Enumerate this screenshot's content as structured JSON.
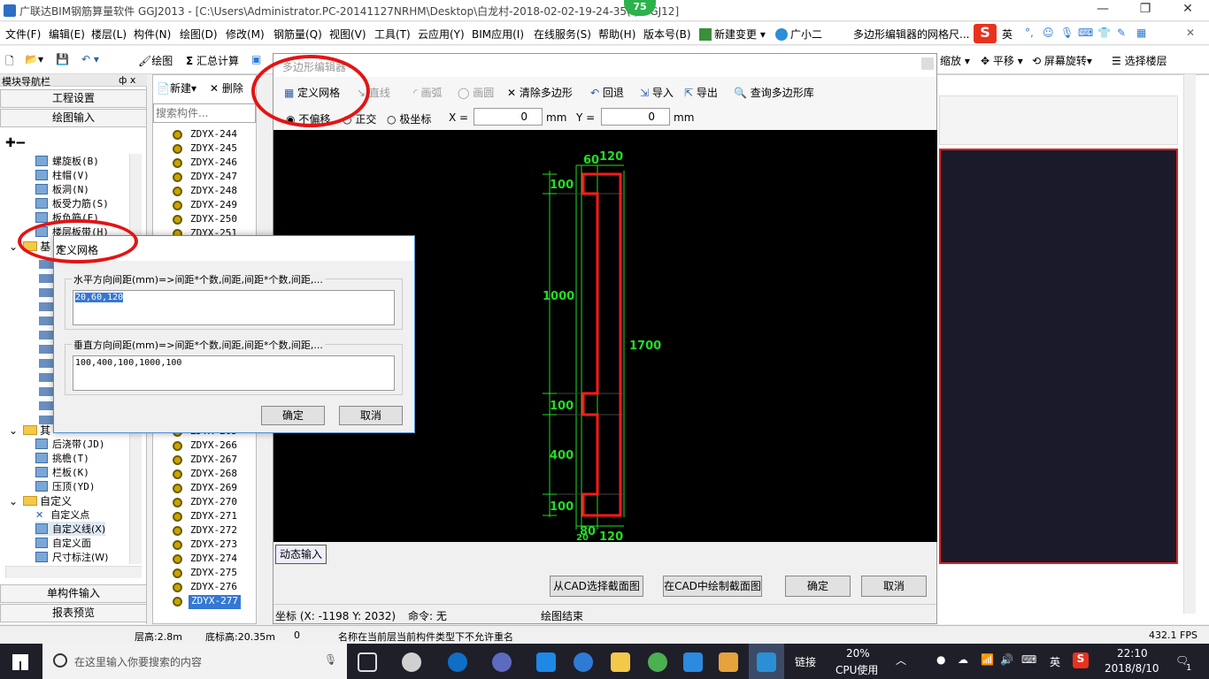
{
  "titlebar": {
    "title": "广联达BIM钢筋算量软件 GGJ2013 - [C:\\Users\\Administrator.PC-20141127NRHM\\Desktop\\白龙村-2018-02-02-19-24-35(    ).GGJ12]",
    "badge": "75"
  },
  "menubar": {
    "items": [
      "文件(F)",
      "编辑(E)",
      "楼层(L)",
      "构件(N)",
      "绘图(D)",
      "修改(M)",
      "钢筋量(Q)",
      "视图(V)",
      "工具(T)",
      "云应用(Y)",
      "BIM应用(I)",
      "在线服务(S)",
      "帮助(H)",
      "版本号(B)",
      "新建变更",
      "广小二"
    ],
    "ticker": "多边形编辑器的网格尺...",
    "ime": "英"
  },
  "toolbar": {
    "draw": "绘图",
    "sum": "汇总计算",
    "zoom": "缩放",
    "pan": "平移",
    "rotate": "屏幕旋转",
    "floor": "选择楼层"
  },
  "nav": {
    "title": "模块导航栏",
    "pin": "ф x",
    "settings": "工程设置",
    "drawinput": "绘图输入",
    "single": "单构件输入",
    "report": "报表预览",
    "items": [
      "螺旋板(B)",
      "柱帽(V)",
      "板洞(N)",
      "板受力筋(S)",
      "板负筋(F)",
      "楼层板带(H)"
    ],
    "folder_base": "基",
    "folder_other": "其",
    "other_items": [
      "后浇带(JD)",
      "挑檐(T)",
      "栏板(K)",
      "压顶(YD)"
    ],
    "folder_custom": "自定义",
    "custom_items": [
      "自定义点",
      "自定义线(X)",
      "自定义面",
      "尺寸标注(W)"
    ]
  },
  "clist": {
    "new": "新建",
    "delete": "删除",
    "search_placeholder": "搜索构件...",
    "top_rows": [
      "ZDYX-244",
      "ZDYX-245",
      "ZDYX-246",
      "ZDYX-247",
      "ZDYX-248",
      "ZDYX-249",
      "ZDYX-250",
      "ZDYX-251"
    ],
    "bottom_rows": [
      "ZDYX-265",
      "ZDYX-266",
      "ZDYX-267",
      "ZDYX-268",
      "ZDYX-269",
      "ZDYX-270",
      "ZDYX-271",
      "ZDYX-272",
      "ZDYX-273",
      "ZDYX-274",
      "ZDYX-275",
      "ZDYX-276",
      "ZDYX-277"
    ]
  },
  "poly": {
    "title": "多边形编辑器",
    "define_grid": "定义网格",
    "line": "直线",
    "arc": "画弧",
    "circle": "画圆",
    "clear": "清除多边形",
    "undo": "回退",
    "import": "导入",
    "export": "导出",
    "query": "查询多边形库",
    "no_offset": "不偏移",
    "ortho": "正交",
    "polar": "极坐标",
    "x_label": "X =",
    "x_value": "0",
    "y_label": "Y =",
    "y_value": "0",
    "unit": "mm",
    "dims": {
      "top_a": "60",
      "top_b": "120",
      "left_1": "100",
      "left_2": "1000",
      "left_3": "100",
      "left_4": "400",
      "left_5": "100",
      "right_total": "1700",
      "bot_a": "20",
      "bot_b": "80",
      "bot_c": "120"
    },
    "dynamic": "动态输入",
    "from_cad": "从CAD选择截面图",
    "in_cad": "在CAD中绘制截面图",
    "ok": "确定",
    "cancel": "取消",
    "coord": "坐标 (X: -1198 Y: 2032)",
    "command": "命令: 无",
    "state": "绘图结束"
  },
  "grid_dialog": {
    "title": "定义网格",
    "h_label": "水平方向间距(mm)=>间距*个数,间距,间距*个数,间距,...",
    "h_value": "20,60,120",
    "v_label": "垂直方向间距(mm)=>间距*个数,间距,间距*个数,间距,...",
    "v_value": "100,400,100,1000,100",
    "ok": "确定",
    "cancel": "取消"
  },
  "status": {
    "floor_h": "层高:2.8m",
    "bottom_h": "底标高:20.35m",
    "zero": "0",
    "msg": "名称在当前层当前构件类型下不允许重名",
    "fps": "432.1 FPS"
  },
  "taskbar": {
    "search": "在这里输入你要搜索的内容",
    "link": "链接",
    "cpu": "20%",
    "cpu_label": "CPU使用",
    "ime": "英",
    "time": "22:10",
    "date": "2018/8/10",
    "notif": "1"
  },
  "colors": {
    "canvas": "#000000",
    "dim": "#22dd22",
    "shape": "#ff1a1a",
    "highlight": "#e31414",
    "accent": "#3478d4"
  }
}
